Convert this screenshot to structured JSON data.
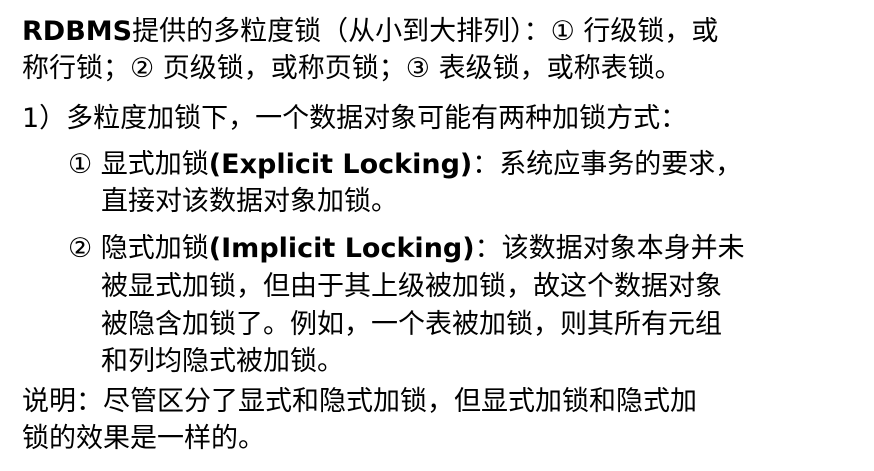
{
  "paragraphs": {
    "intro_line1_prefix": "RDBMS",
    "intro_line1_rest": "提供的多粒度锁（从小到大排列）：① 行级锁，或",
    "intro_line2": "称行锁；② 页级锁，或称页锁；③ 表级锁，或称表锁。",
    "point1": "1）多粒度加锁下，一个数据对象可能有两种加锁方式：",
    "explicit_line1_prefix": "① 显式加锁",
    "explicit_line1_term": "(Explicit Locking)",
    "explicit_line1_suffix": "：系统应事务的要求，",
    "explicit_line2": "直接对该数据对象加锁。",
    "implicit_line1_prefix": "② 隐式加锁",
    "implicit_line1_term": "(Implicit Locking)",
    "implicit_line1_suffix": "：该数据对象本身并未",
    "implicit_line2": "被显式加锁，但由于其上级被加锁，故这个数据对象",
    "implicit_line3": "被隐含加锁了。例如，一个表被加锁，则其所有元组",
    "implicit_line4": "和列均隐式被加锁。",
    "note_line1": "说明：尽管区分了显式和隐式加锁，但显式加锁和隐式加",
    "note_line2": "锁的效果是一样的。"
  }
}
